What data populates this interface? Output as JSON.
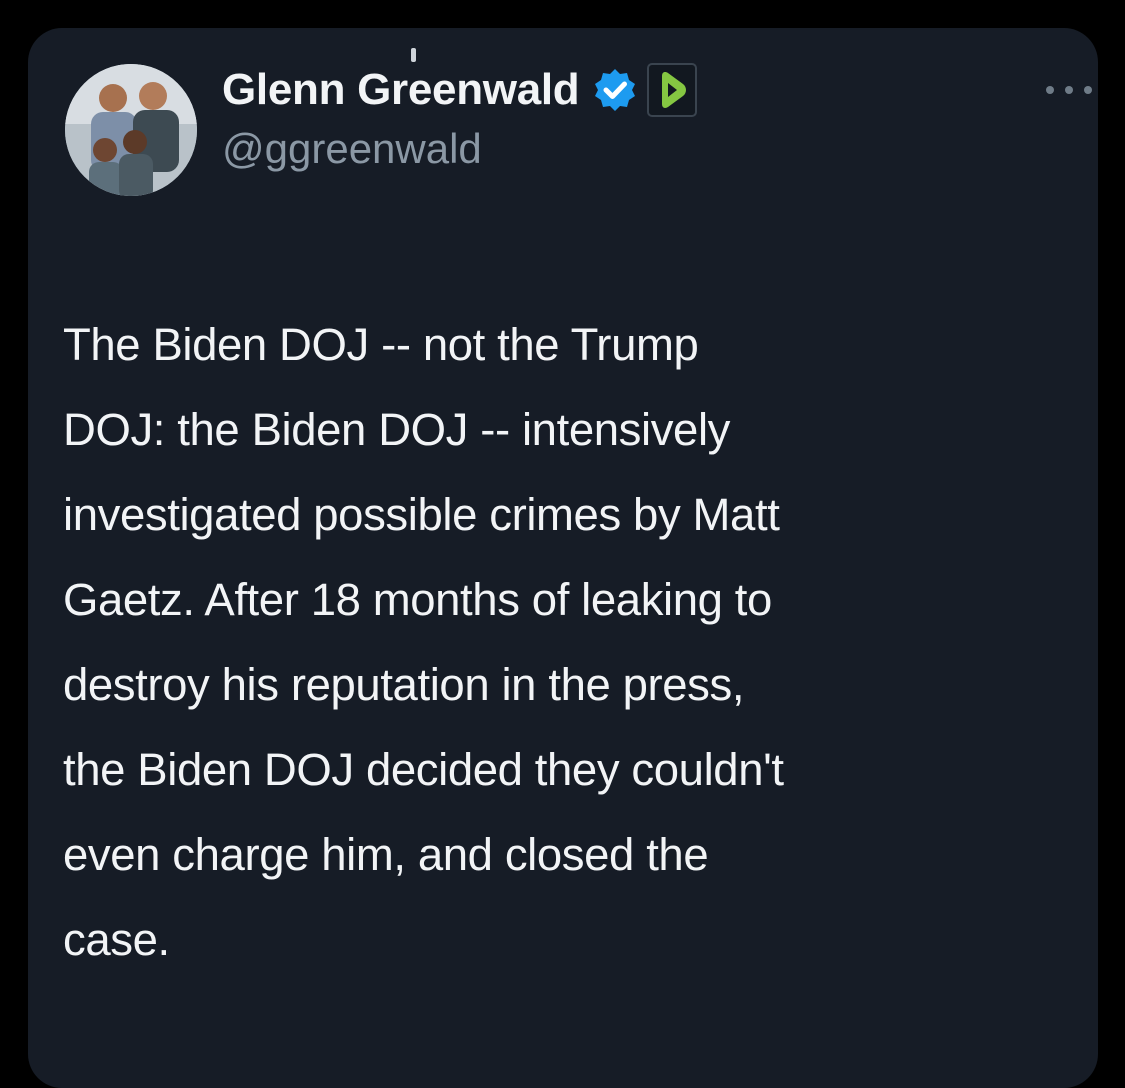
{
  "tweet": {
    "author": {
      "display_name": "Glenn Greenwald",
      "handle": "@ggreenwald",
      "avatar_icon": "profile-photo",
      "verified_icon": "verified-badge-icon",
      "affiliate_icon": "rumble-logo-icon"
    },
    "more_icon": "ellipsis-icon",
    "text": "The Biden DOJ -- not the Trump\nDOJ: the Biden DOJ -- intensively\ninvestigated possible crimes by Matt\nGaetz. After 18 months of leaking to\ndestroy his reputation in the press,\nthe Biden DOJ decided they couldn't\neven charge him, and closed the\ncase."
  },
  "colors": {
    "background": "#000000",
    "card": "#161c26",
    "primary_text": "#f2f4f6",
    "secondary_text": "#8b98a5",
    "verified_blue": "#1d9bf0",
    "rumble_green": "#85c742"
  }
}
